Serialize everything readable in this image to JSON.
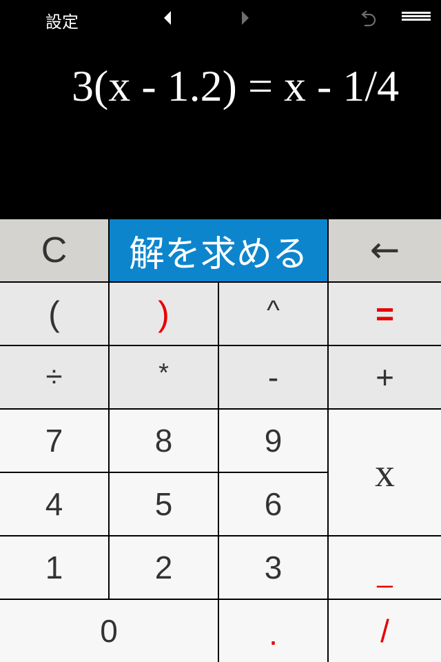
{
  "topbar": {
    "settings_label": "設定",
    "prev_icon": "triangle-left-icon",
    "next_icon": "triangle-right-icon",
    "undo_icon": "undo-icon",
    "menu_icon": "hamburger-menu-icon"
  },
  "display": {
    "equation": "3(x - 1.2) = x - 1/4"
  },
  "keys": {
    "clear": "C",
    "solve": "解を求める",
    "backspace": "←",
    "paren_open": "(",
    "paren_close": ")",
    "power": "^",
    "equals": "=",
    "divide": "÷",
    "multiply": "*",
    "minus": "-",
    "plus": "+",
    "seven": "7",
    "eight": "8",
    "nine": "9",
    "variable_x": "x",
    "four": "4",
    "five": "5",
    "six": "6",
    "one": "1",
    "two": "2",
    "three": "3",
    "fraction_bar": "_",
    "zero": "0",
    "decimal": ".",
    "slash": "/"
  },
  "colors": {
    "solve_bg": "#0d85cd",
    "accent_red": "#e60000",
    "top_row_bg": "#d4d3cf",
    "operator_bg": "#e8e8e8",
    "number_bg": "#f7f7f7"
  }
}
